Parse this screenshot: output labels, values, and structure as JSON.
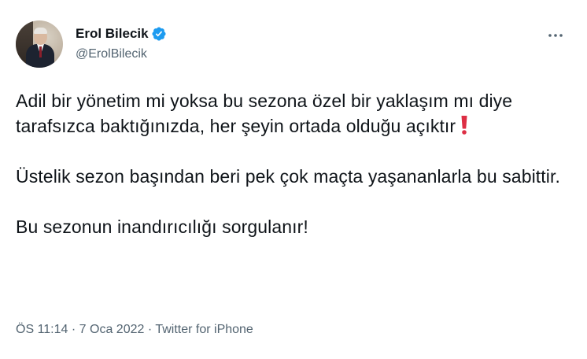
{
  "tweet": {
    "author": {
      "name": "Erol Bilecik",
      "handle": "@ErolBilecik",
      "verified": true
    },
    "paragraphs": [
      "Adil bir yönetim mi yoksa bu sezona özel bir yaklaşım mı diye tarafsızca baktığınızda, her şeyin ortada olduğu açıktır",
      "Üstelik sezon başından beri pek çok maçta yaşananlarla bu sabittir.",
      "Bu sezonun inandırıcılığı sorgulanır!"
    ],
    "emoji": "❗",
    "time": "ÖS 11:14",
    "separator": "·",
    "date": "7 Oca 2022",
    "source": "Twitter for iPhone"
  },
  "colors": {
    "text": "#0f1419",
    "secondary": "#536471",
    "verified": "#1d9bf0",
    "emoji": "#dd2e44"
  },
  "icons": {
    "verified": "verified-badge-icon",
    "more": "more-options-icon",
    "emoji": "red-exclamation-mark-icon"
  }
}
